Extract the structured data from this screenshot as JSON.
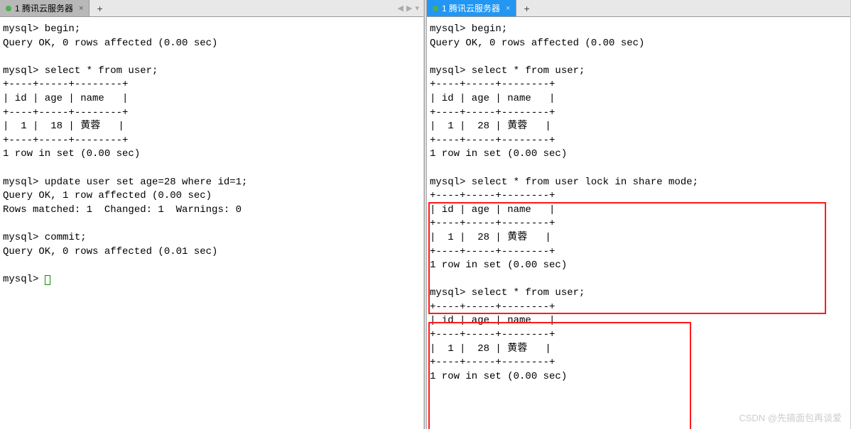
{
  "left": {
    "tab": {
      "label": "1 腾讯云服务器"
    },
    "terminal": "mysql> begin;\nQuery OK, 0 rows affected (0.00 sec)\n\nmysql> select * from user;\n+----+-----+--------+\n| id | age | name   |\n+----+-----+--------+\n|  1 |  18 | 黄蓉   |\n+----+-----+--------+\n1 row in set (0.00 sec)\n\nmysql> update user set age=28 where id=1;\nQuery OK, 1 row affected (0.00 sec)\nRows matched: 1  Changed: 1  Warnings: 0\n\nmysql> commit;\nQuery OK, 0 rows affected (0.01 sec)\n\nmysql> "
  },
  "right": {
    "tab": {
      "label": "1 腾讯云服务器"
    },
    "terminal": "mysql> begin;\nQuery OK, 0 rows affected (0.00 sec)\n\nmysql> select * from user;\n+----+-----+--------+\n| id | age | name   |\n+----+-----+--------+\n|  1 |  28 | 黄蓉   |\n+----+-----+--------+\n1 row in set (0.00 sec)\n\nmysql> select * from user lock in share mode;\n+----+-----+--------+\n| id | age | name   |\n+----+-----+--------+\n|  1 |  28 | 黄蓉   |\n+----+-----+--------+\n1 row in set (0.00 sec)\n\nmysql> select * from user;\n+----+-----+--------+\n| id | age | name   |\n+----+-----+--------+\n|  1 |  28 | 黄蓉   |\n+----+-----+--------+\n1 row in set (0.00 sec)"
  },
  "icons": {
    "close": "×",
    "add": "+",
    "nav_left": "◀",
    "nav_right": "▶",
    "dropdown": "▾"
  },
  "watermark": "CSDN @先搞面包再谈爱"
}
